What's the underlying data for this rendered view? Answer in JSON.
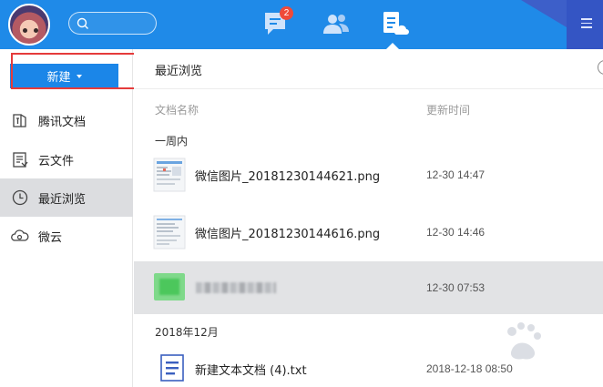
{
  "header": {
    "search_placeholder": "",
    "message_badge": "2",
    "icons": [
      "avatar",
      "search-icon",
      "message-icon",
      "contacts-icon",
      "docs-icon",
      "menu-icon"
    ],
    "colors": {
      "bar": "#1f8ae8",
      "accent": "#1b86e8",
      "badge": "#ef4a3a"
    }
  },
  "sidebar": {
    "new_button": "新建",
    "items": [
      {
        "label": "腾讯文档",
        "icon": "tencent-docs-icon"
      },
      {
        "label": "云文件",
        "icon": "cloud-file-icon"
      },
      {
        "label": "最近浏览",
        "icon": "clock-icon"
      },
      {
        "label": "微云",
        "icon": "weiyun-icon"
      }
    ]
  },
  "main": {
    "title": "最近浏览",
    "columns": {
      "name": "文档名称",
      "time": "更新时间"
    },
    "groups": [
      {
        "label": "一周内",
        "rows": [
          {
            "name": "微信图片_20181230144621.png",
            "time": "12-30 14:47"
          },
          {
            "name": "微信图片_20181230144616.png",
            "time": "12-30 14:46"
          },
          {
            "name": "",
            "time": "12-30 07:53"
          }
        ]
      },
      {
        "label": "2018年12月",
        "rows": [
          {
            "name": "新建文本文档 (4).txt",
            "time": "2018-12-18 08:50"
          }
        ]
      }
    ]
  }
}
